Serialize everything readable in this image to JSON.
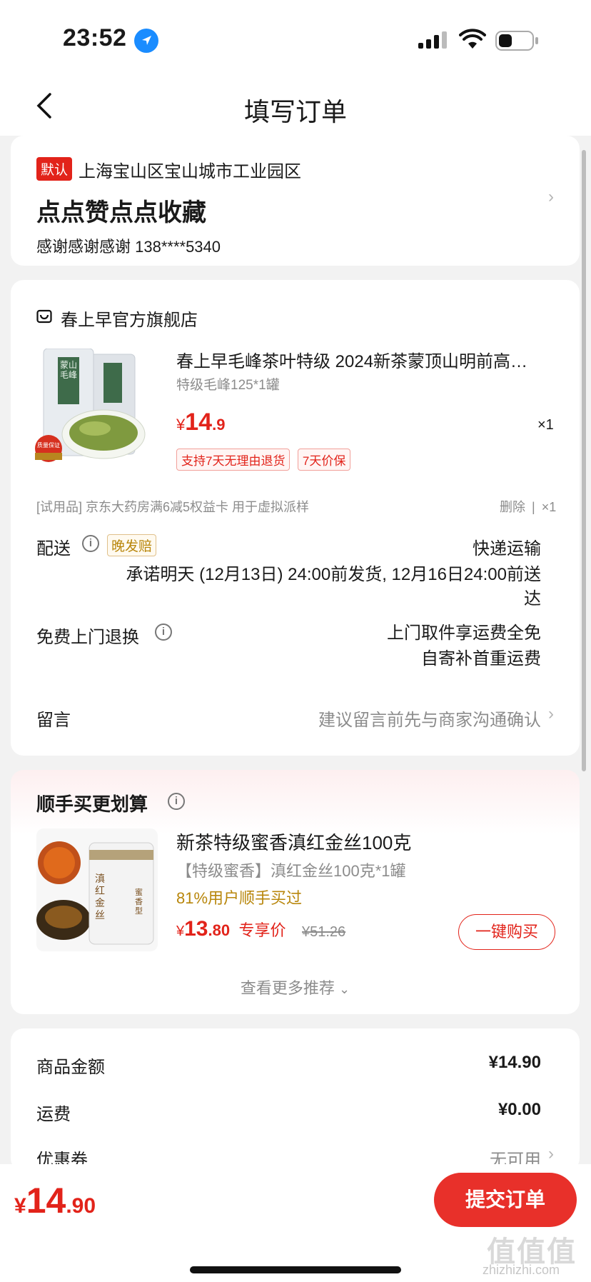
{
  "status_bar": {
    "time": "23:52"
  },
  "header": {
    "title": "填写订单"
  },
  "address": {
    "default_tag": "默认",
    "region": "上海宝山区宝山城市工业园区",
    "detail": "点点赞点点收藏",
    "contact": "感谢感谢感谢  138****5340"
  },
  "store": {
    "name": "春上早官方旗舰店",
    "product": {
      "title": "春上早毛峰茶叶特级 2024新茶蒙顶山明前高…",
      "spec": "特级毛峰125*1罐",
      "currency": "¥",
      "price_int": "14",
      "price_dec": ".9",
      "qty": "×1",
      "badges": [
        "支持7天无理由退货",
        "7天价保"
      ],
      "quality_tag": "质量保证",
      "image_label": "蒙山毛峰"
    },
    "trial": {
      "text": "[试用品] 京东大药房满6减5权益卡 用于虚拟派样",
      "delete": "删除",
      "sep": "|",
      "qty": "×1"
    },
    "delivery": {
      "label": "配送",
      "badge": "晚发赔",
      "method": "快递运输",
      "promise_line1": "承诺明天 (12月13日) 24:00前发货, 12月16日24:00前送",
      "promise_line2": "达"
    },
    "return": {
      "label": "免费上门退换",
      "line1": "上门取件享运费全免",
      "line2": "自寄补首重运费"
    },
    "message": {
      "label": "留言",
      "placeholder": "建议留言前先与商家沟通确认"
    }
  },
  "recommend": {
    "title": "顺手买更划算",
    "product": {
      "title": "新茶特级蜜香滇红金丝100克",
      "spec": "【特级蜜香】滇红金丝100克*1罐",
      "social": "81%用户顺手买过",
      "currency": "¥",
      "price_int": "13",
      "price_dec": ".80",
      "price_label": "专享价",
      "original_price": "¥51.26",
      "buy_button": "一键购买",
      "image_label": "滇红金丝",
      "image_label2": "蜜香型"
    },
    "more": "查看更多推荐"
  },
  "summary": {
    "goods_label": "商品金额",
    "goods_value": "¥14.90",
    "shipping_label": "运费",
    "shipping_value": "¥0.00",
    "coupon_label": "优惠券",
    "coupon_value": "无可用"
  },
  "footer": {
    "currency": "¥",
    "total_int": "14",
    "total_dec": ".90",
    "submit": "提交订单",
    "watermark": "值值值",
    "watermark_url": "zhizhizhi.com"
  },
  "colors": {
    "accent": "#e2231a",
    "button": "#e8302a",
    "gold": "#b8860b",
    "blue": "#1a8cff"
  }
}
